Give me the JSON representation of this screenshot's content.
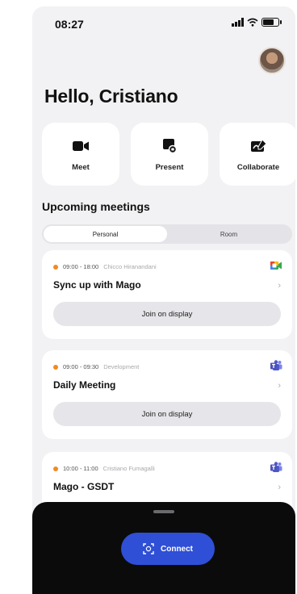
{
  "status_bar": {
    "time": "08:27"
  },
  "greeting": "Hello, Cristiano",
  "actions": [
    {
      "label": "Meet",
      "icon": "video-camera-icon"
    },
    {
      "label": "Present",
      "icon": "present-screen-icon"
    },
    {
      "label": "Collaborate",
      "icon": "whiteboard-pen-icon"
    }
  ],
  "section_title": "Upcoming meetings",
  "tabs": [
    {
      "label": "Personal",
      "active": true
    },
    {
      "label": "Room",
      "active": false
    }
  ],
  "meetings": [
    {
      "time": "09:00 - 18:00",
      "owner": "Chicco Hiranandani",
      "title": "Sync up with Mago",
      "join_label": "Join on display",
      "app_icon": "google-meet-icon",
      "status_color": "#f08a24"
    },
    {
      "time": "09:00 - 09:30",
      "owner": "Development",
      "title": "Daily Meeting",
      "join_label": "Join on display",
      "app_icon": "microsoft-teams-icon",
      "status_color": "#f08a24"
    },
    {
      "time": "10:00 - 11:00",
      "owner": "Cristiano Fumagalli",
      "title": "Mago - GSDT",
      "app_icon": "microsoft-teams-icon",
      "status_color": "#f08a24"
    }
  ],
  "bottom_sheet": {
    "connect_label": "Connect",
    "connect_icon": "scan-frame-icon"
  },
  "colors": {
    "accent": "#2f4fd6",
    "status_dot": "#f08a24",
    "background": "#f2f2f4"
  }
}
